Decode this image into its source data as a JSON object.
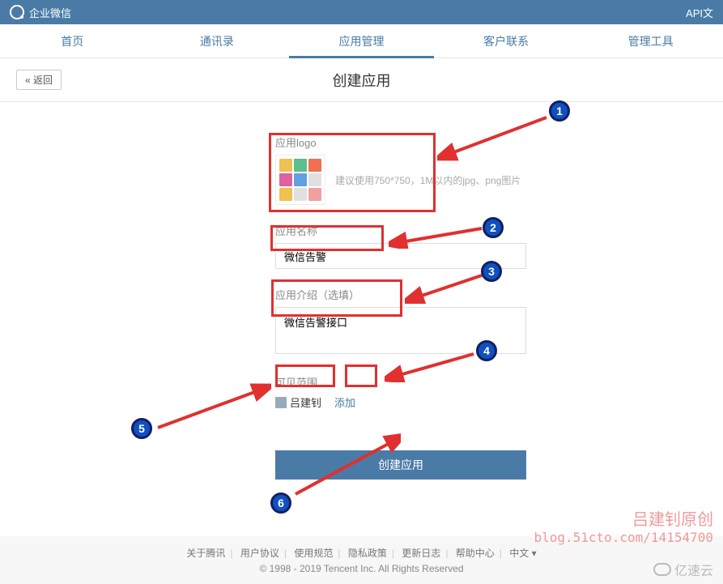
{
  "topbar": {
    "brand": "企业微信",
    "api": "API文"
  },
  "nav": {
    "home": "首页",
    "contacts": "通讯录",
    "apps": "应用管理",
    "customer": "客户联系",
    "tools": "管理工具"
  },
  "page": {
    "back": "« 返回",
    "title": "创建应用"
  },
  "form": {
    "logo_label": "应用logo",
    "logo_hint": "建议使用750*750，1M以内的jpg、png图片",
    "name_label": "应用名称",
    "name_value": "微信告警",
    "desc_label": "应用介绍（选填）",
    "desc_value": "微信告警接口",
    "scope_label": "可见范围",
    "member": "吕建钊",
    "add": "添加",
    "submit": "创建应用"
  },
  "markers": {
    "m1": "1",
    "m2": "2",
    "m3": "3",
    "m4": "4",
    "m5": "5",
    "m6": "6"
  },
  "footer": {
    "about": "关于腾讯",
    "agreement": "用户协议",
    "rules": "使用规范",
    "privacy": "隐私政策",
    "changelog": "更新日志",
    "help": "帮助中心",
    "lang": "中文 ▾",
    "copyright": "© 1998 - 2019 Tencent Inc. All Rights Reserved"
  },
  "watermark": {
    "title": "吕建钊原创",
    "url": "blog.51cto.com/14154700"
  },
  "yisu": "亿速云"
}
